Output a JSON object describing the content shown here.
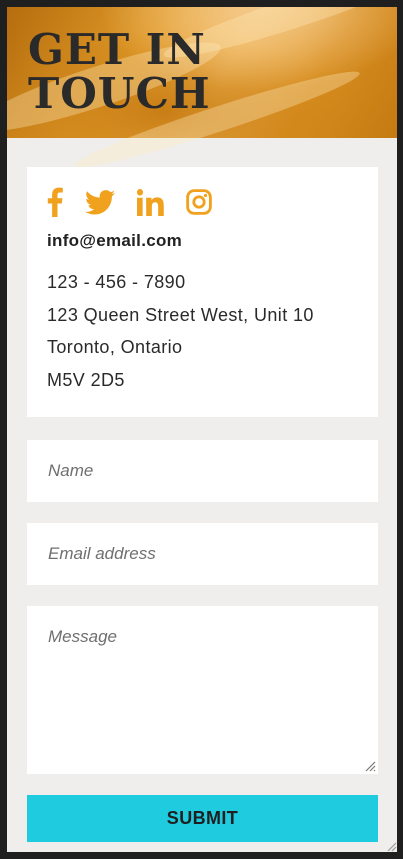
{
  "hero": {
    "title": "GET IN\nTOUCH"
  },
  "contact": {
    "socials": [
      "facebook-icon",
      "twitter-icon",
      "linkedin-icon",
      "instagram-icon"
    ],
    "accent_color": "#f0a21f",
    "email": "info@email.com",
    "phone": "123 - 456 - 7890",
    "address_line1": "123 Queen Street West, Unit 10",
    "address_line2": "Toronto, Ontario",
    "postal_code": "M5V 2D5"
  },
  "form": {
    "name_placeholder": "Name",
    "email_placeholder": "Email address",
    "message_placeholder": "Message",
    "submit_label": "SUBMIT",
    "submit_color": "#1fcbdf"
  }
}
